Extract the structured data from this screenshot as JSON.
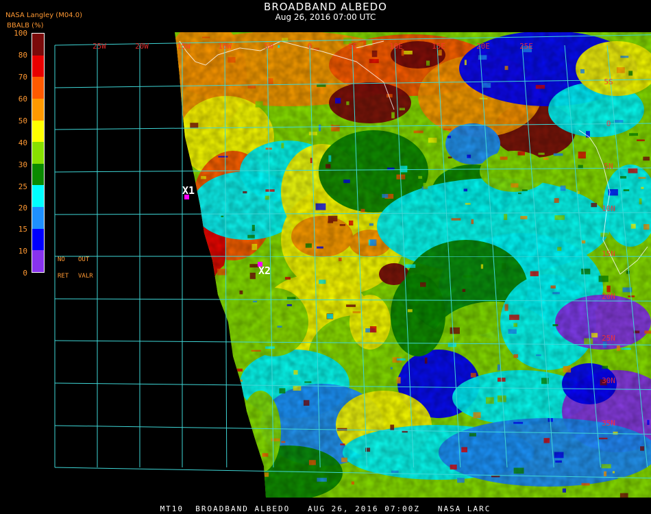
{
  "header": {
    "title": "BROADBAND ALBEDO",
    "datetime": "Aug 26, 2016 07:00 UTC",
    "product": "NASA Langley (M04.0)",
    "units": "BBALB (%)"
  },
  "legend": {
    "ticks": [
      "100",
      "80",
      "70",
      "60",
      "50",
      "40",
      "30",
      "25",
      "20",
      "15",
      "10",
      "0"
    ],
    "colors": [
      "#7a0a0a",
      "#e80000",
      "#ff5a00",
      "#ff9900",
      "#ffff00",
      "#88e000",
      "#0a8a00",
      "#00ffff",
      "#1e90ff",
      "#0000ff",
      "#8833ee"
    ],
    "notes": [
      "NO",
      "OUT",
      "RET",
      "VALR"
    ]
  },
  "map": {
    "lon_labels": [
      "25W",
      "20W",
      "15W",
      "10W",
      "5W",
      "0",
      "5E",
      "10E",
      "15E",
      "20E",
      "25E"
    ],
    "lat_labels": [
      "5S",
      "0",
      "5N",
      "10N",
      "15N",
      "20N",
      "25N",
      "30N",
      "35N"
    ],
    "markers": [
      {
        "label": "X1",
        "color": "#ff00ff"
      },
      {
        "label": "X2",
        "color": "#ff00ff"
      }
    ],
    "grid_color": "#3fd7d7"
  },
  "footer": "MT10  BROADBAND ALBEDO   AUG 26, 2016 07:00Z   NASA LARC"
}
